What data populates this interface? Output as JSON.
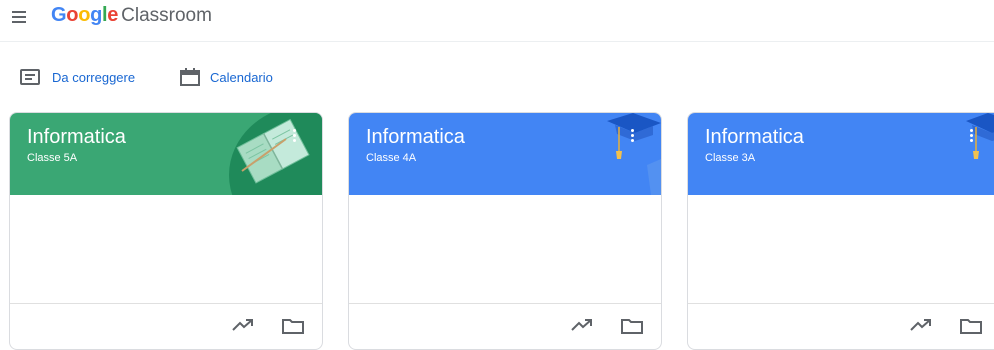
{
  "app": {
    "logo_google": "Google",
    "logo_product": "Classroom",
    "google_colors": [
      "#4285f4",
      "#ea4335",
      "#fbbc05",
      "#4285f4",
      "#34a853",
      "#ea4335"
    ]
  },
  "toolbar": {
    "to_review_label": "Da correggere",
    "to_review_icon": "assignment-review-icon",
    "calendar_label": "Calendario",
    "calendar_icon": "calendar-icon"
  },
  "classes": [
    {
      "title": "Informatica",
      "section": "Classe 5A",
      "theme_color": "#3aa774",
      "art": "open-book"
    },
    {
      "title": "Informatica",
      "section": "Classe 4A",
      "theme_color": "#4285f4",
      "art": "graduation-cap"
    },
    {
      "title": "Informatica",
      "section": "Classe 3A",
      "theme_color": "#4285f4",
      "art": "graduation-cap"
    }
  ],
  "card_footer_icons": [
    "trending-up-icon",
    "folder-icon"
  ],
  "card_menu_icon": "more-vert-icon"
}
